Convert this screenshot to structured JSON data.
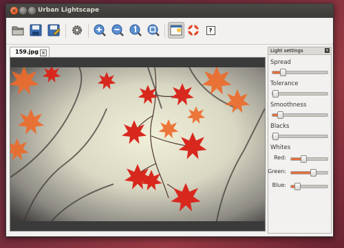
{
  "window": {
    "title": "Urban Lightscape"
  },
  "toolbar": {
    "buttons": [
      {
        "name": "open-icon",
        "tip": "Open"
      },
      {
        "name": "save-icon",
        "tip": "Save"
      },
      {
        "name": "save-as-icon",
        "tip": "Save As"
      },
      {
        "name": "settings-icon",
        "tip": "Settings"
      },
      {
        "name": "zoom-in-icon",
        "tip": "Zoom In"
      },
      {
        "name": "zoom-out-icon",
        "tip": "Zoom Out"
      },
      {
        "name": "zoom-1to1-icon",
        "tip": "1:1"
      },
      {
        "name": "zoom-fit-icon",
        "tip": "Fit"
      },
      {
        "name": "light-settings-toggle-icon",
        "tip": "Light settings"
      },
      {
        "name": "help-icon",
        "tip": "Help"
      },
      {
        "name": "about-icon",
        "tip": "About"
      }
    ],
    "about_label": "?"
  },
  "tab": {
    "label": "159.jpg",
    "close": "×"
  },
  "panel": {
    "title": "Light settings",
    "close": "×",
    "sliders": {
      "spread": {
        "label": "Spread",
        "value": 0.15
      },
      "tolerance": {
        "label": "Tolerance",
        "value": 0.0
      },
      "smoothness": {
        "label": "Smoothness",
        "value": 0.1
      },
      "blacks": {
        "label": "Blacks",
        "value": 0.0
      }
    },
    "whites": {
      "label": "Whites",
      "red": {
        "label": "Red:",
        "value": 0.3
      },
      "green": {
        "label": "Green:",
        "value": 0.6
      },
      "blue": {
        "label": "Blue:",
        "value": 0.1
      }
    }
  },
  "colors": {
    "accent": "#e36f3f",
    "titlebar": "#3c3b37"
  }
}
